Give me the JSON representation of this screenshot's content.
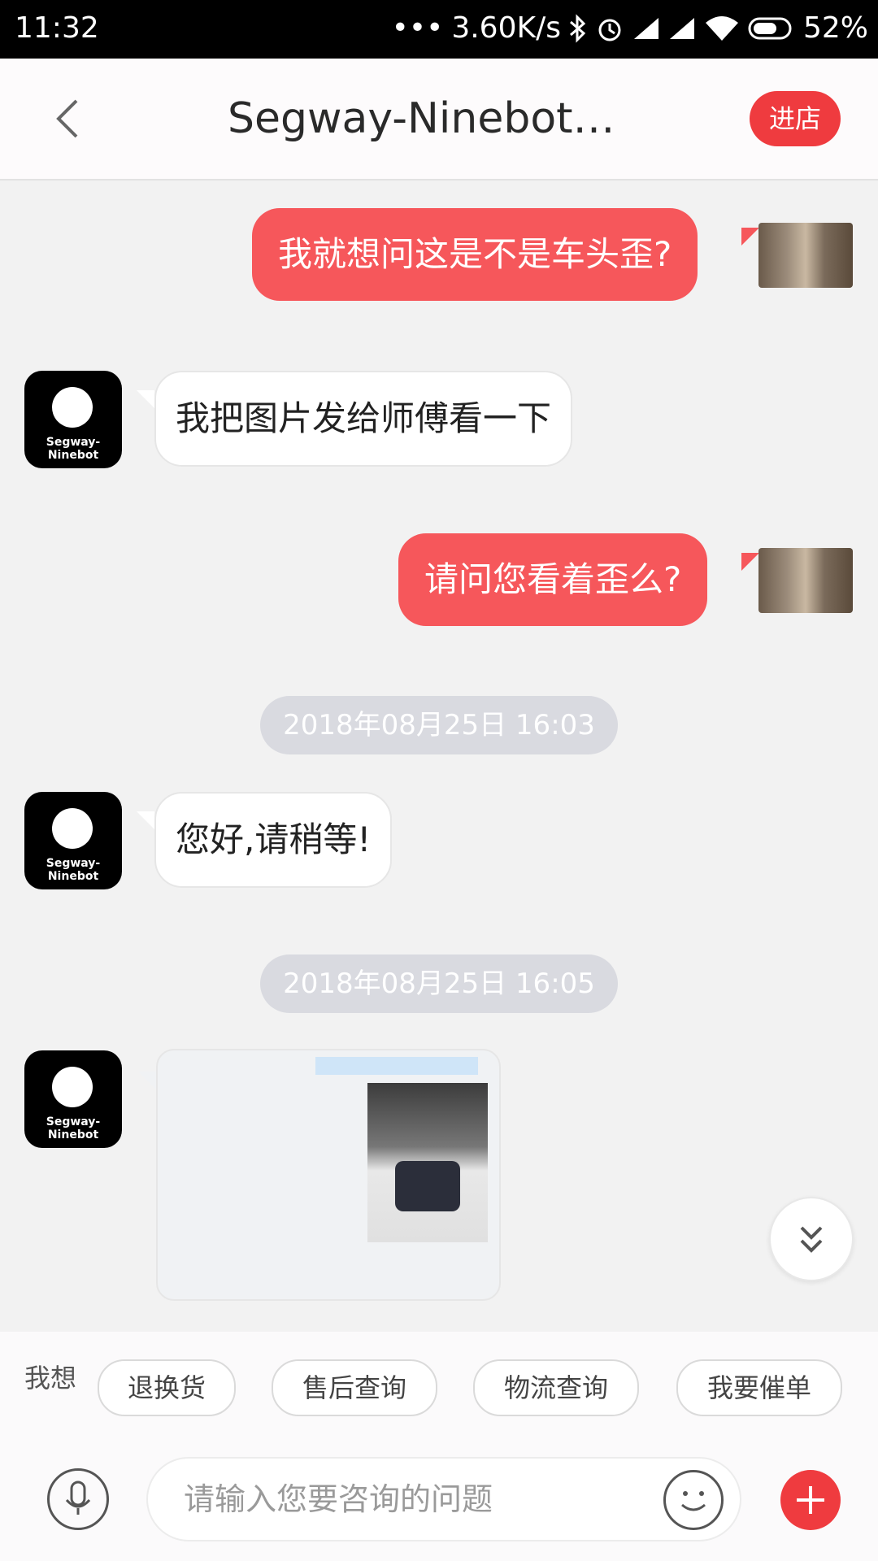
{
  "status_bar": {
    "time": "11:32",
    "net_speed": "3.60K/s",
    "battery": "52%"
  },
  "header": {
    "title": "Segway-Ninebot京...",
    "enter_store": "进店"
  },
  "brand": {
    "avatar_text": "Segway-Ninebot"
  },
  "messages": [
    {
      "side": "out",
      "text": "我就想问这是不是车头歪?"
    },
    {
      "side": "in",
      "text": "我把图片发给师傅看一下"
    },
    {
      "side": "out",
      "text": "请问您看着歪么?"
    },
    {
      "side": "time",
      "text": "2018年08月25日 16:03"
    },
    {
      "side": "in",
      "text": "您好,请稍等!"
    },
    {
      "side": "time",
      "text": "2018年08月25日 16:05"
    },
    {
      "side": "in-image",
      "text": ""
    }
  ],
  "quick_bar": {
    "label": "我想",
    "chips": [
      "退换货",
      "售后查询",
      "物流查询",
      "我要催单"
    ]
  },
  "input": {
    "placeholder": "请输入您要咨询的问题"
  },
  "colors": {
    "accent": "#ef3b3f",
    "outgoing_bubble": "#f6575b",
    "timestamp_bg": "#d9dae0"
  }
}
